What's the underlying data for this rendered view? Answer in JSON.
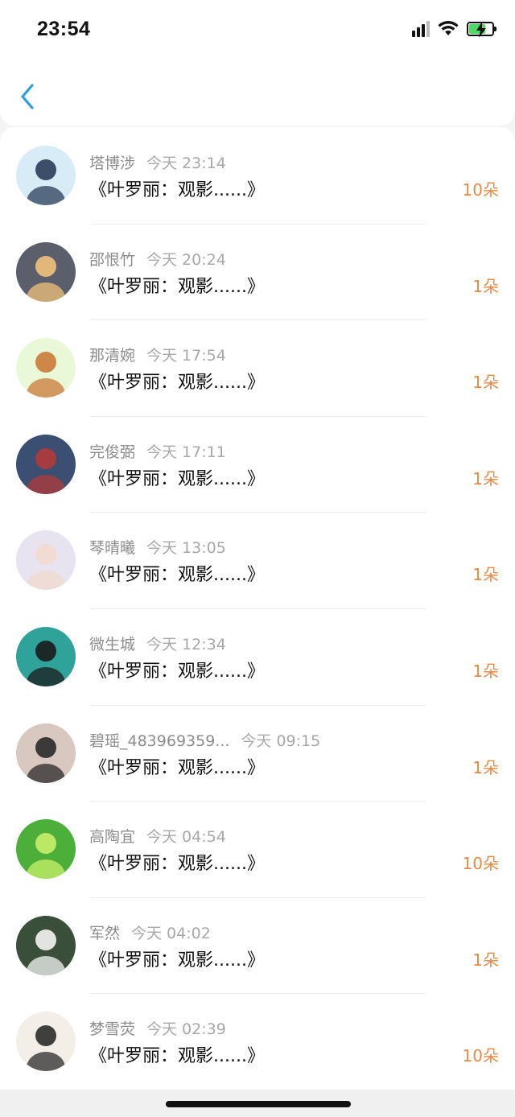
{
  "status_bar": {
    "time": "23:54"
  },
  "gifts": [
    {
      "name": "塔博涉",
      "time": "今天 23:14",
      "title": "《叶罗丽：观影......》",
      "amount": "10朵",
      "avatar_bg": "#d7ecf7",
      "avatar_fg": "#2a3d5a"
    },
    {
      "name": "邵恨竹",
      "time": "今天 20:24",
      "title": "《叶罗丽：观影......》",
      "amount": "1朵",
      "avatar_bg": "#5b5f6b",
      "avatar_fg": "#f0c27b"
    },
    {
      "name": "那清婉",
      "time": "今天 17:54",
      "title": "《叶罗丽：观影......》",
      "amount": "1朵",
      "avatar_bg": "#e9f9d8",
      "avatar_fg": "#c97a3a"
    },
    {
      "name": "完俊弼",
      "time": "今天 17:11",
      "title": "《叶罗丽：观影......》",
      "amount": "1朵",
      "avatar_bg": "#3b4f73",
      "avatar_fg": "#b23a3a"
    },
    {
      "name": "琴晴曦",
      "time": "今天 13:05",
      "title": "《叶罗丽：观影......》",
      "amount": "1朵",
      "avatar_bg": "#e8e4ef",
      "avatar_fg": "#f3d9cf"
    },
    {
      "name": "微生城",
      "time": "今天 12:34",
      "title": "《叶罗丽：观影......》",
      "amount": "1朵",
      "avatar_bg": "#2fa39a",
      "avatar_fg": "#1b1b1b"
    },
    {
      "name": "碧瑶_483969359...",
      "time": "今天 09:15",
      "title": "《叶罗丽：观影......》",
      "amount": "1朵",
      "avatar_bg": "#d9c8c0",
      "avatar_fg": "#2a2a2a"
    },
    {
      "name": "高陶宜",
      "time": "今天 04:54",
      "title": "《叶罗丽：观影......》",
      "amount": "10朵",
      "avatar_bg": "#4caf3a",
      "avatar_fg": "#c8f06a"
    },
    {
      "name": "军然",
      "time": "今天 04:02",
      "title": "《叶罗丽：观影......》",
      "amount": "1朵",
      "avatar_bg": "#3a4f3a",
      "avatar_fg": "#f4f4f4"
    },
    {
      "name": "梦雪荧",
      "time": "今天 02:39",
      "title": "《叶罗丽：观影......》",
      "amount": "10朵",
      "avatar_bg": "#f3eee8",
      "avatar_fg": "#2b2b2b"
    }
  ],
  "colors": {
    "accent": "#2f9de0",
    "amount": "#e88a44",
    "battery": "#4cd964"
  },
  "battery_level": 0.72
}
